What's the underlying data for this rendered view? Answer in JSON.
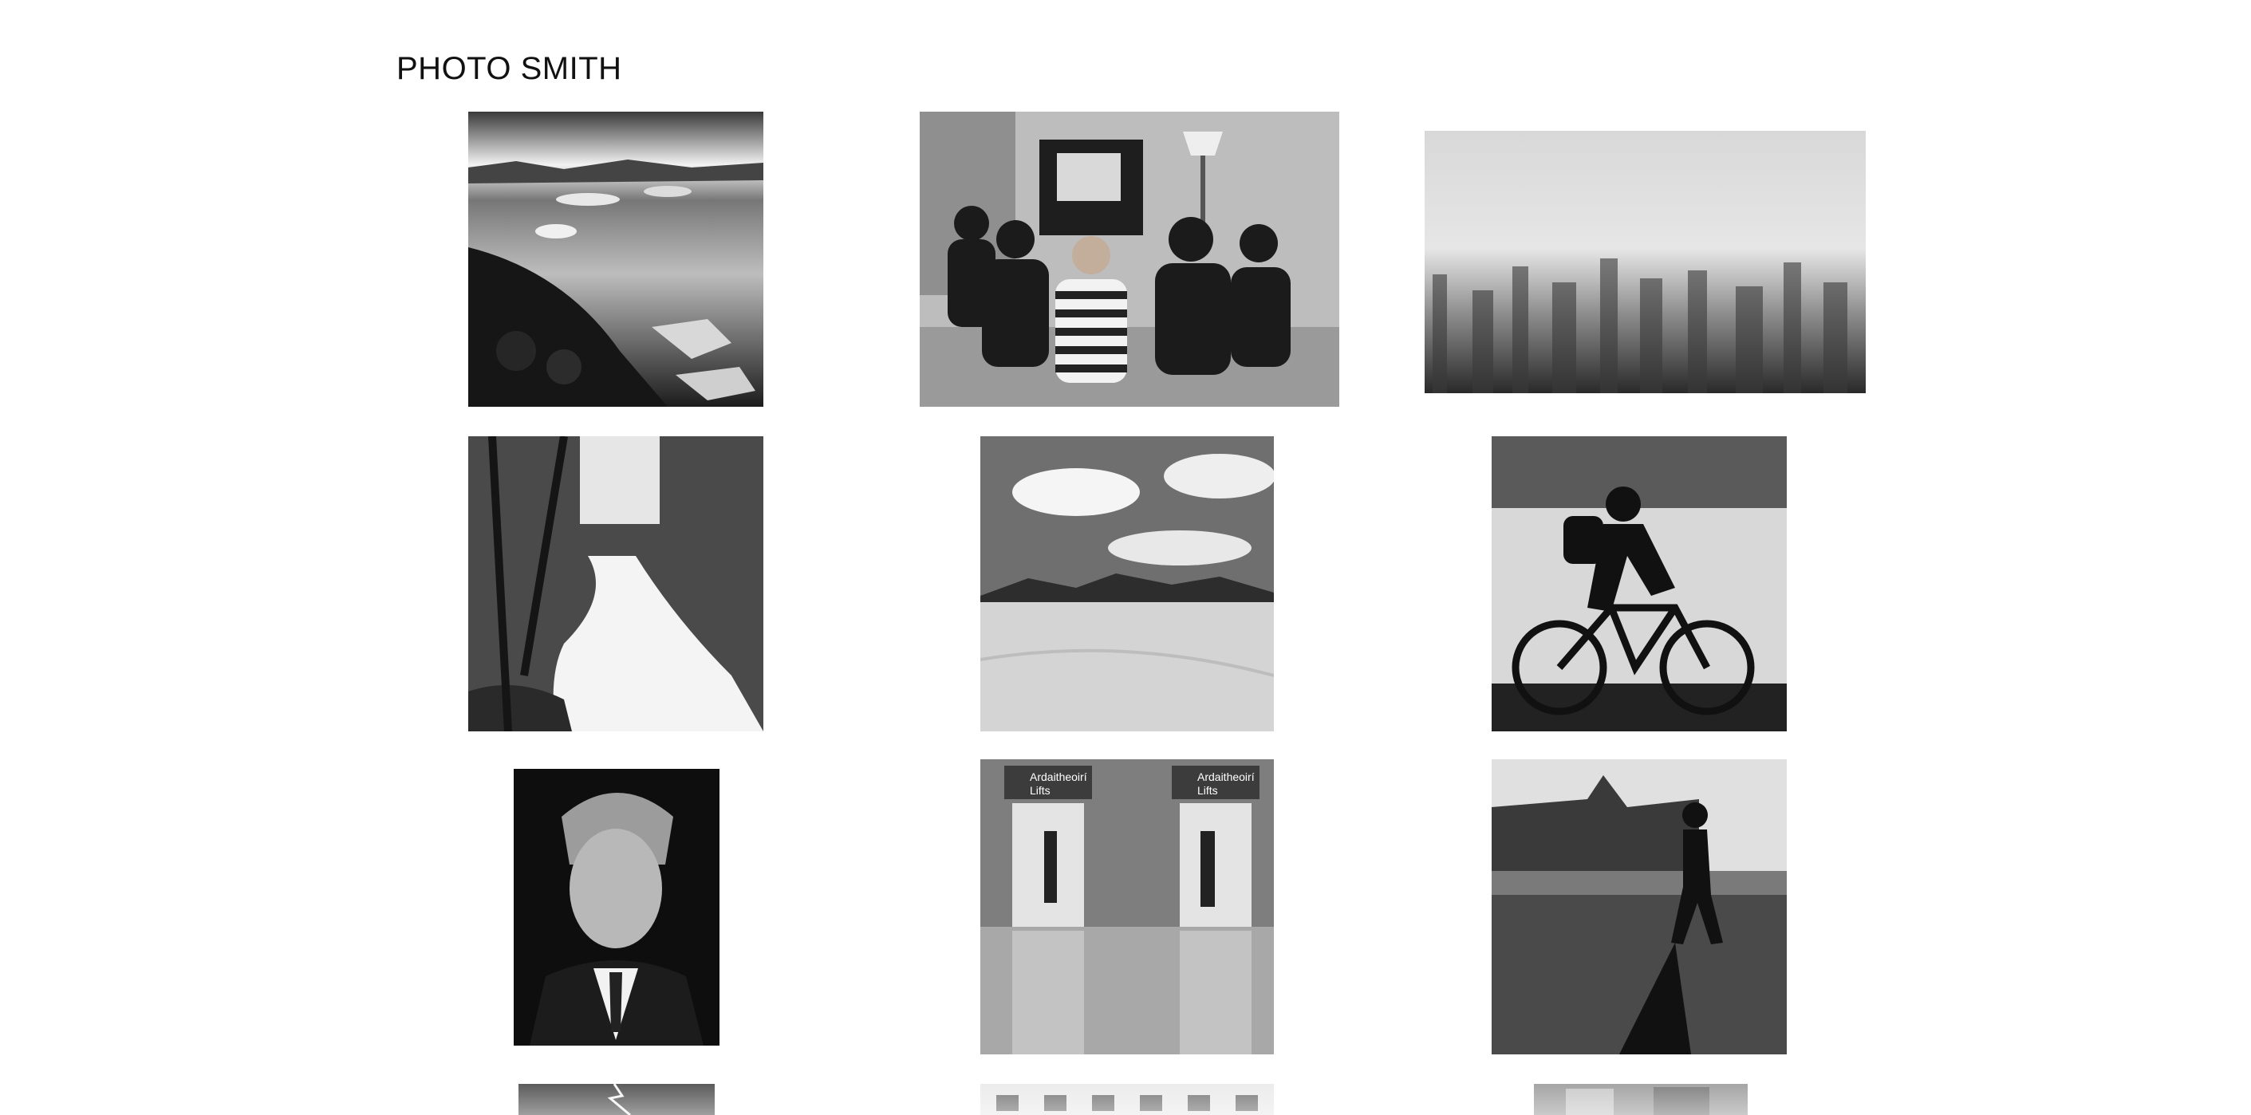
{
  "site": {
    "title": "PHOTO SMITH"
  },
  "gallery": {
    "photos": [
      {
        "subject": "icy lake shoreline",
        "icon": "landscape-icon"
      },
      {
        "subject": "children watching tv",
        "icon": "people-icon"
      },
      {
        "subject": "blurred city skyline",
        "icon": "city-icon"
      },
      {
        "subject": "forest waterfall",
        "icon": "waterfall-icon"
      },
      {
        "subject": "desert dunes and clouds",
        "icon": "desert-icon"
      },
      {
        "subject": "cyclist silhouette",
        "icon": "cyclist-icon"
      },
      {
        "subject": "man portrait",
        "icon": "portrait-icon"
      },
      {
        "subject": "airport lifts",
        "icon": "lifts-icon",
        "signs": [
          "Ardaitheoirí",
          "Lifts",
          "Ardaitheoirí",
          "Lifts"
        ]
      },
      {
        "subject": "walker by building",
        "icon": "street-icon"
      },
      {
        "subject": "lightning storm",
        "icon": "lightning-icon"
      },
      {
        "subject": "building facade",
        "icon": "building-icon"
      },
      {
        "subject": "street scene",
        "icon": "street-icon"
      }
    ]
  }
}
